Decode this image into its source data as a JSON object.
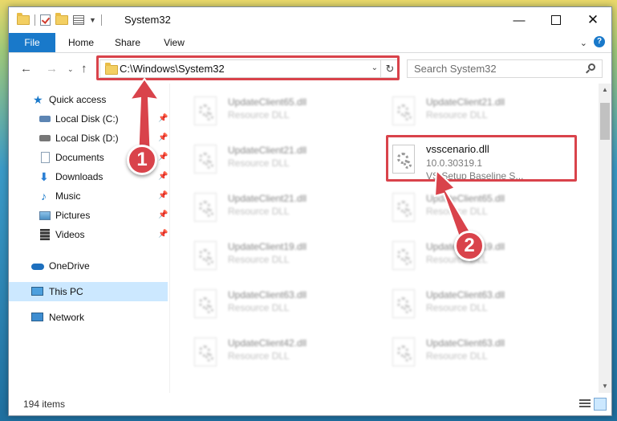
{
  "window": {
    "title": "System32"
  },
  "ribbon": {
    "tabs": [
      "File",
      "Home",
      "Share",
      "View"
    ]
  },
  "address": {
    "path": "C:\\Windows\\System32"
  },
  "search": {
    "placeholder": "Search System32"
  },
  "sidebar": {
    "items": [
      {
        "label": "Quick access",
        "icon": "star-icon",
        "pinned": false
      },
      {
        "label": "Local Disk (C:)",
        "icon": "drive-icon",
        "pinned": true
      },
      {
        "label": "Local Disk (D:)",
        "icon": "drive-icon",
        "pinned": true
      },
      {
        "label": "Documents",
        "icon": "documents-icon",
        "pinned": true
      },
      {
        "label": "Downloads",
        "icon": "download-icon",
        "pinned": true
      },
      {
        "label": "Music",
        "icon": "music-icon",
        "pinned": true
      },
      {
        "label": "Pictures",
        "icon": "pictures-icon",
        "pinned": true
      },
      {
        "label": "Videos",
        "icon": "videos-icon",
        "pinned": true
      },
      {
        "label": "OneDrive",
        "icon": "cloud-icon",
        "pinned": false
      },
      {
        "label": "This PC",
        "icon": "computer-icon",
        "pinned": false,
        "selected": true
      },
      {
        "label": "Network",
        "icon": "network-icon",
        "pinned": false
      }
    ]
  },
  "files": {
    "left": [
      {
        "name": "UpdateClient65.dll",
        "desc": "Resource DLL"
      },
      {
        "name": "UpdateClient21.dll",
        "desc": "Resource DLL"
      },
      {
        "name": "UpdateClient21.dll",
        "desc": "Resource DLL"
      },
      {
        "name": "UpdateClient19.dll",
        "desc": "Resource DLL"
      },
      {
        "name": "UpdateClient63.dll",
        "desc": "Resource DLL"
      },
      {
        "name": "UpdateClient42.dll",
        "desc": "Resource DLL"
      }
    ],
    "right": [
      {
        "name": "UpdateClient21.dll",
        "desc": "Resource DLL"
      },
      {
        "name": "UpdateClient65.dll",
        "desc": "Resource DLL"
      },
      {
        "name": "UpdateClient19.dll",
        "desc": "Resource DLL"
      },
      {
        "name": "UpdateClient63.dll",
        "desc": "Resource DLL"
      },
      {
        "name": "UpdateClient63.dll",
        "desc": "Resource DLL"
      }
    ],
    "focused": {
      "name": "vsscenario.dll",
      "version": "10.0.30319.1",
      "desc": "VS Setup Baseline S..."
    }
  },
  "status": {
    "count": "194 items"
  },
  "annotations": {
    "step1": "1",
    "step2": "2",
    "color": "#d9434b"
  }
}
